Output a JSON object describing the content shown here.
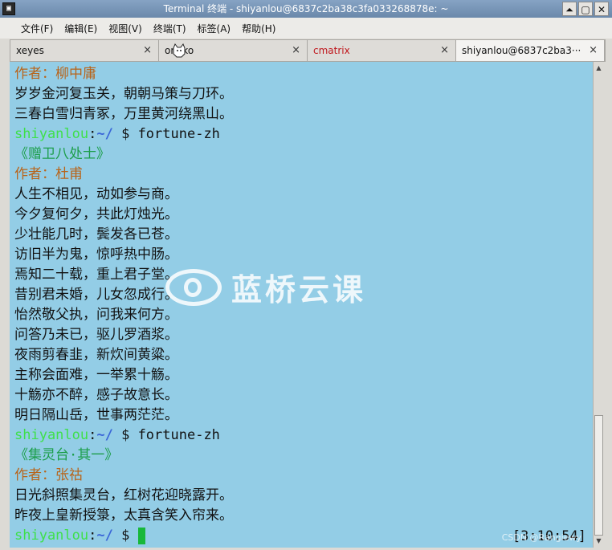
{
  "window": {
    "title": "Terminal 终端 - shiyanlou@6837c2ba38c3fa033268878e: ~",
    "icon_glyph": "▣",
    "buttons": [
      "⏶",
      "▢",
      "✕"
    ]
  },
  "menubar": {
    "items": [
      "文件(F)",
      "编辑(E)",
      "视图(V)",
      "终端(T)",
      "标签(A)",
      "帮助(H)"
    ]
  },
  "tabs": [
    {
      "label": "xeyes",
      "close": "×",
      "color": "#111111"
    },
    {
      "label": "oneko",
      "close": "×",
      "color": "#111111"
    },
    {
      "label": "cmatrix",
      "close": "×",
      "color": "#c0161c"
    },
    {
      "label": "shiyanlou@6837c2ba3···",
      "close": "×",
      "color": "#111111"
    }
  ],
  "terminal": {
    "lines": [
      {
        "type": "author",
        "text": "作者：柳中庸"
      },
      {
        "type": "text",
        "text": "岁岁金河复玉关，朝朝马策与刀环。"
      },
      {
        "type": "text",
        "text": "三春白雪归青冢，万里黄河绕黑山。"
      },
      {
        "type": "prompt",
        "user": "shiyanlou",
        "path": "~/",
        "cmd": " $ fortune-zh"
      },
      {
        "type": "title",
        "text": "《赠卫八处士》"
      },
      {
        "type": "author",
        "text": "作者：杜甫"
      },
      {
        "type": "text",
        "text": "人生不相见，动如参与商。"
      },
      {
        "type": "text",
        "text": "今夕复何夕，共此灯烛光。"
      },
      {
        "type": "text",
        "text": "少壮能几时，鬓发各已苍。"
      },
      {
        "type": "text",
        "text": "访旧半为鬼，惊呼热中肠。"
      },
      {
        "type": "text",
        "text": "焉知二十载，重上君子堂。"
      },
      {
        "type": "text",
        "text": "昔别君未婚，儿女忽成行。"
      },
      {
        "type": "text",
        "text": "怡然敬父执，问我来何方。"
      },
      {
        "type": "text",
        "text": "问答乃未已，驱儿罗酒浆。"
      },
      {
        "type": "text",
        "text": "夜雨剪春韭，新炊间黄粱。"
      },
      {
        "type": "text",
        "text": "主称会面难，一举累十觞。"
      },
      {
        "type": "text",
        "text": "十觞亦不醉，感子故意长。"
      },
      {
        "type": "text",
        "text": "明日隔山岳，世事两茫茫。"
      },
      {
        "type": "prompt",
        "user": "shiyanlou",
        "path": "~/",
        "cmd": " $ fortune-zh"
      },
      {
        "type": "title",
        "text": "《集灵台·其一》"
      },
      {
        "type": "author",
        "text": "作者：张祜"
      },
      {
        "type": "text",
        "text": "日光斜照集灵台，红树花迎晓露开。"
      },
      {
        "type": "text",
        "text": "昨夜上皇新授箓，太真含笑入帘来。"
      },
      {
        "type": "prompt-cursor",
        "user": "shiyanlou",
        "path": "~/",
        "cmd": " $ "
      }
    ],
    "clock": "[3:10:54]"
  },
  "watermark": {
    "text": "蓝桥云课",
    "credit": "CSDN @Rangiewy"
  },
  "colors": {
    "terminal_bg": "#93cde6",
    "author": "#b8641a",
    "title": "#1c9e4a",
    "prompt_user": "#3ee04a",
    "prompt_path": "#3a66d8"
  }
}
